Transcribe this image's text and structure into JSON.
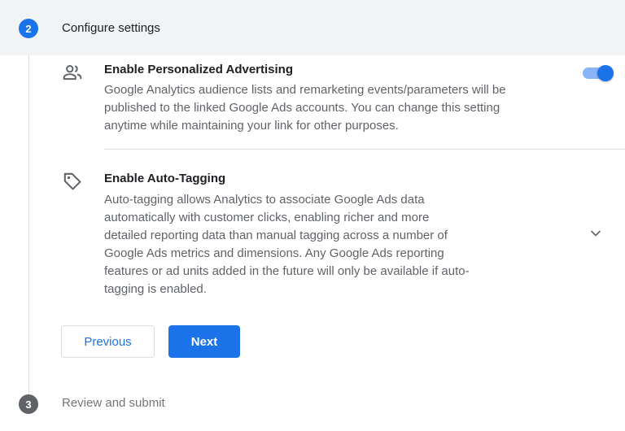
{
  "step2": {
    "number": "2",
    "title": "Configure settings"
  },
  "settings": [
    {
      "icon": "people-icon",
      "title": "Enable Personalized Advertising",
      "description_lines": [
        "Google Analytics audience lists and remarketing events/parameters will be",
        "published to the linked Google Ads accounts. You can change this setting",
        "anytime while maintaining your link for other purposes."
      ],
      "enabled": true
    },
    {
      "icon": "tag-icon",
      "title": "Enable Auto-Tagging",
      "description_lines": [
        "Auto-tagging allows Analytics to associate Google Ads data",
        "automatically with customer clicks, enabling richer and more",
        "detailed reporting data than manual tagging across a number of",
        "Google Ads metrics and dimensions. Any Google Ads reporting",
        "features or ad units added in the future will only be available if auto-",
        "tagging is enabled."
      ]
    }
  ],
  "buttons": {
    "previous": "Previous",
    "next": "Next"
  },
  "step3": {
    "number": "3",
    "title": "Review and submit"
  },
  "colors": {
    "accent": "#1a73e8",
    "toggle_track": "#8ab4f8",
    "header_bg": "#f1f3f4",
    "inactive_step": "#5f6368"
  }
}
